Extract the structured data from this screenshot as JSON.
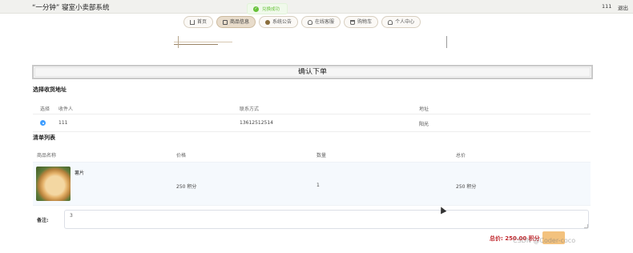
{
  "header": {
    "app_title": "“一分钟” 寝室小卖部系统",
    "user_name": "111",
    "logout_label": "退出"
  },
  "toast": {
    "message": "兑换成功",
    "icon": "check-circle-icon",
    "color": "#67c23a"
  },
  "nav": {
    "items": [
      {
        "label": "首页",
        "icon": "home-icon"
      },
      {
        "label": "商品信息",
        "icon": "bag-icon",
        "active": true
      },
      {
        "label": "系统公告",
        "icon": "bell-icon"
      },
      {
        "label": "在线客服",
        "icon": "headset-icon"
      },
      {
        "label": "购物车",
        "icon": "cart-icon"
      },
      {
        "label": "个人中心",
        "icon": "user-icon"
      }
    ]
  },
  "confirm_order_label": "确认下单",
  "address": {
    "section_title": "选择收货地址",
    "columns": [
      "选择",
      "收件人",
      "联系方式",
      "地址"
    ],
    "rows": [
      {
        "selected": true,
        "recipient": "111",
        "phone": "13612512514",
        "address": "阳光"
      }
    ]
  },
  "goods": {
    "section_title": "清单列表",
    "columns": [
      "商品名称",
      "价格",
      "数量",
      "总价"
    ],
    "rows": [
      {
        "name": "薯片",
        "price": "250 积分",
        "quantity": "1",
        "total": "250 积分"
      }
    ]
  },
  "remark": {
    "label": "备注:",
    "value": "3"
  },
  "summary": {
    "total_label": "总价: 250.00 积分"
  },
  "watermark": "CSDN @Coder-coco",
  "colors": {
    "accent": "#409eff",
    "total": "#c0272d",
    "submit": "#f3c27e",
    "nav_active": "#e8dccb"
  }
}
